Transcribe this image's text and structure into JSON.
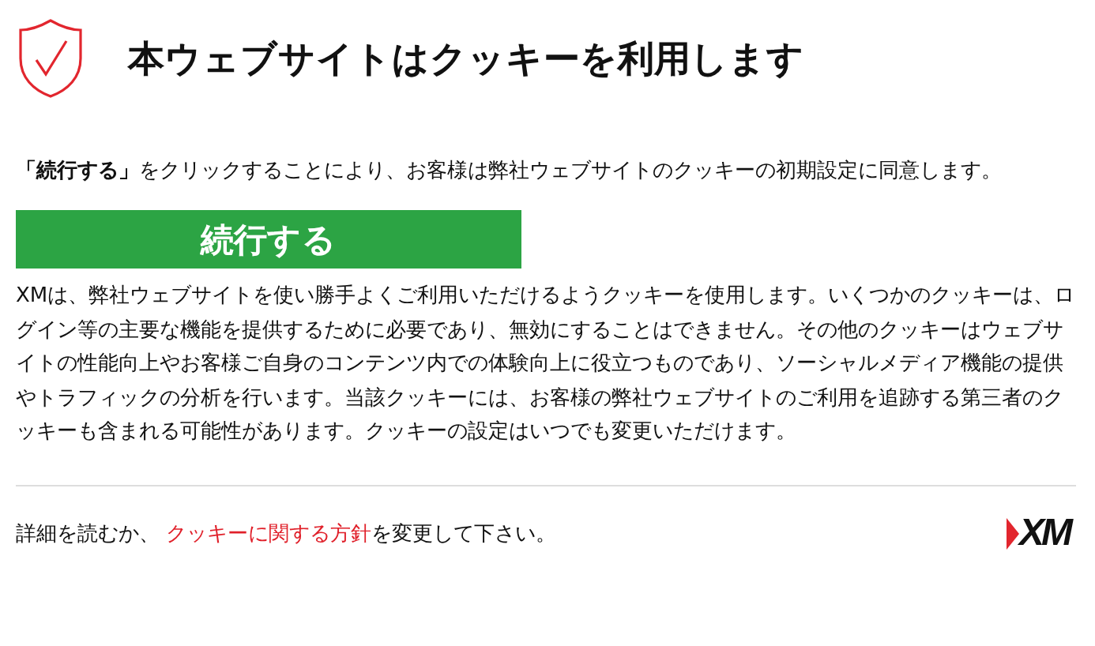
{
  "title": "本ウェブサイトはクッキーを利用します",
  "consent_text": "**「続行する」**をクリックすることにより、お客様は弊社ウェブサイトのクッキーの初期設定に同意します。",
  "continue_button": "続行する",
  "description": "XMは、弊社ウェブサイトを使い勝手よくご利用いただけるようクッキーを使用します。いくつかのクッキーは、ログイン等の主要な機能を提供するために必要であり、無効にすることはできません。その他のクッキーはウェブサイトの性能向上やお客様ご自身のコンテンツ内での体験向上に役立つものであり、ソーシャルメディア機能の提供やトラフィックの分析を行います。当該クッキーには、お客様の弊社ウェブサイトのご利用を追跡する第三者のクッキーも含まれる可能性があります。クッキーの設定はいつでも変更いただけます。",
  "footer": {
    "before": "詳細を読むか、 ",
    "link": "クッキーに関する方針",
    "after": "を変更して下さい。"
  },
  "logo": "XM"
}
